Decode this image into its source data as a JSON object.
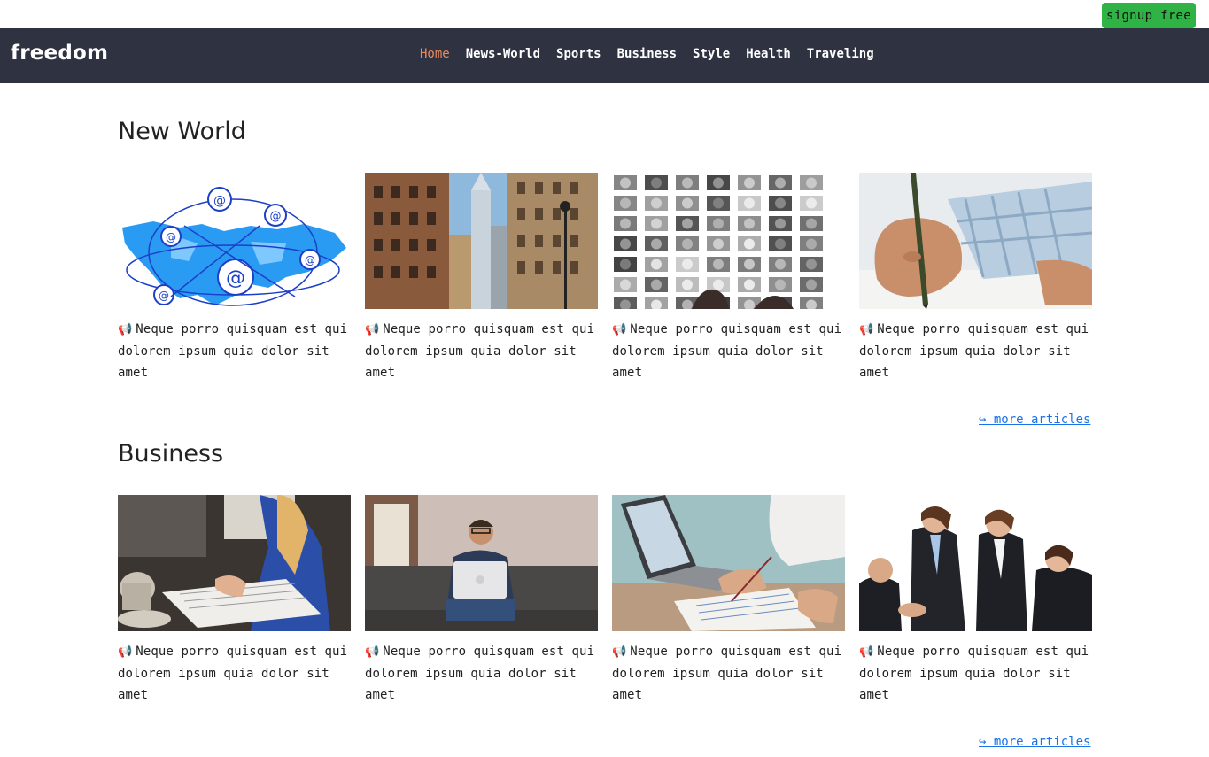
{
  "signup_label": "signup free",
  "brand": "freedom",
  "nav": [
    {
      "label": "Home",
      "active": true
    },
    {
      "label": "News-World"
    },
    {
      "label": "Sports"
    },
    {
      "label": "Business"
    },
    {
      "label": "Style"
    },
    {
      "label": "Health"
    },
    {
      "label": "Traveling"
    }
  ],
  "sections": [
    {
      "title": "New World",
      "cards": [
        {
          "image": "world-map-email",
          "text": "Neque porro quisquam est qui dolorem ipsum quia dolor sit amet"
        },
        {
          "image": "city-skyscrapers",
          "text": "Neque porro quisquam est qui dolorem ipsum quia dolor sit amet"
        },
        {
          "image": "faces-collage",
          "text": "Neque porro quisquam est qui dolorem ipsum quia dolor sit amet"
        },
        {
          "image": "hand-writing-pencil",
          "text": "Neque porro quisquam est qui dolorem ipsum quia dolor sit amet"
        }
      ],
      "more_label": "↪ more articles"
    },
    {
      "title": "Business",
      "cards": [
        {
          "image": "woman-writing-notebook",
          "text": "Neque porro quisquam est qui dolorem ipsum quia dolor sit amet"
        },
        {
          "image": "man-with-laptop-sofa",
          "text": "Neque porro quisquam est qui dolorem ipsum quia dolor sit amet"
        },
        {
          "image": "laptop-documents-desk",
          "text": "Neque porro quisquam est qui dolorem ipsum quia dolor sit amet"
        },
        {
          "image": "business-team-handshake",
          "text": "Neque porro quisquam est qui dolorem ipsum quia dolor sit amet"
        }
      ],
      "more_label": "↪ more articles"
    }
  ],
  "icons": {
    "card_icon": "megaphone-icon"
  },
  "colors": {
    "navbar": "#2e3241",
    "active_nav": "#f08a5d",
    "signup": "#2fb344",
    "link": "#1a73e8"
  }
}
